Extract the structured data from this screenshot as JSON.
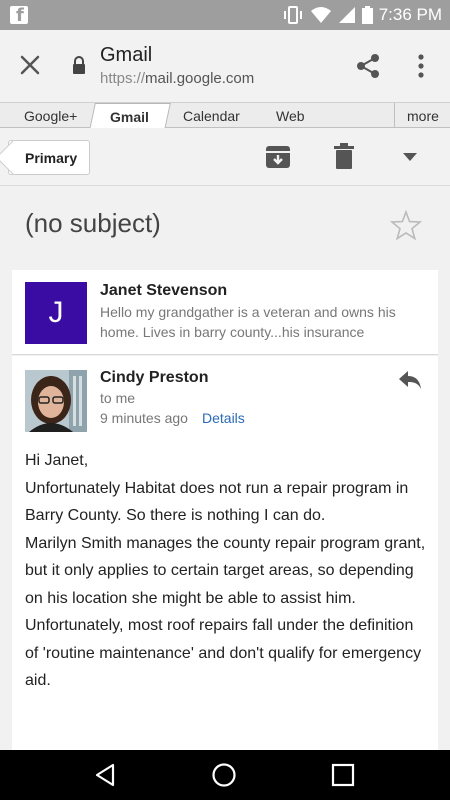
{
  "status_bar": {
    "time": "7:36 PM"
  },
  "browser": {
    "title": "Gmail",
    "url_scheme": "https://",
    "url_host": "mail.google.com"
  },
  "tabs": {
    "items": [
      "Google+",
      "Gmail",
      "Calendar",
      "Web"
    ],
    "active": "Gmail",
    "more": "more"
  },
  "toolbar": {
    "primary_label": "Primary"
  },
  "thread": {
    "subject": "(no subject)"
  },
  "messages": [
    {
      "avatar_letter": "J",
      "sender": "Janet Stevenson",
      "snippet": "Hello my grandgather is a veteran and owns his home. Lives in barry county...his insurance"
    },
    {
      "sender": "Cindy Preston",
      "to": "to me",
      "time": "9 minutes ago",
      "details": "Details",
      "body": [
        "Hi Janet,",
        "Unfortunately Habitat does not run a repair program in Barry County. So there is nothing I can do.",
        "Marilyn Smith manages the county repair program grant, but it only applies to certain target areas, so depending on his location she might be able to assist him.",
        "Unfortunately, most roof repairs fall under the definition of 'routine maintenance' and don't qualify for emergency aid."
      ]
    }
  ],
  "colors": {
    "avatar_j": "#3a0ca3",
    "link": "#2a6bb5",
    "status_bar": "#9e9e9e"
  },
  "icons": [
    "facebook-icon",
    "vibrate-icon",
    "wifi-icon",
    "signal-icon",
    "battery-icon",
    "close-icon",
    "lock-icon",
    "share-icon",
    "overflow-menu-icon",
    "archive-icon",
    "trash-icon",
    "chevron-down-icon",
    "star-icon",
    "reply-icon",
    "nav-back-icon",
    "nav-home-icon",
    "nav-recents-icon"
  ]
}
